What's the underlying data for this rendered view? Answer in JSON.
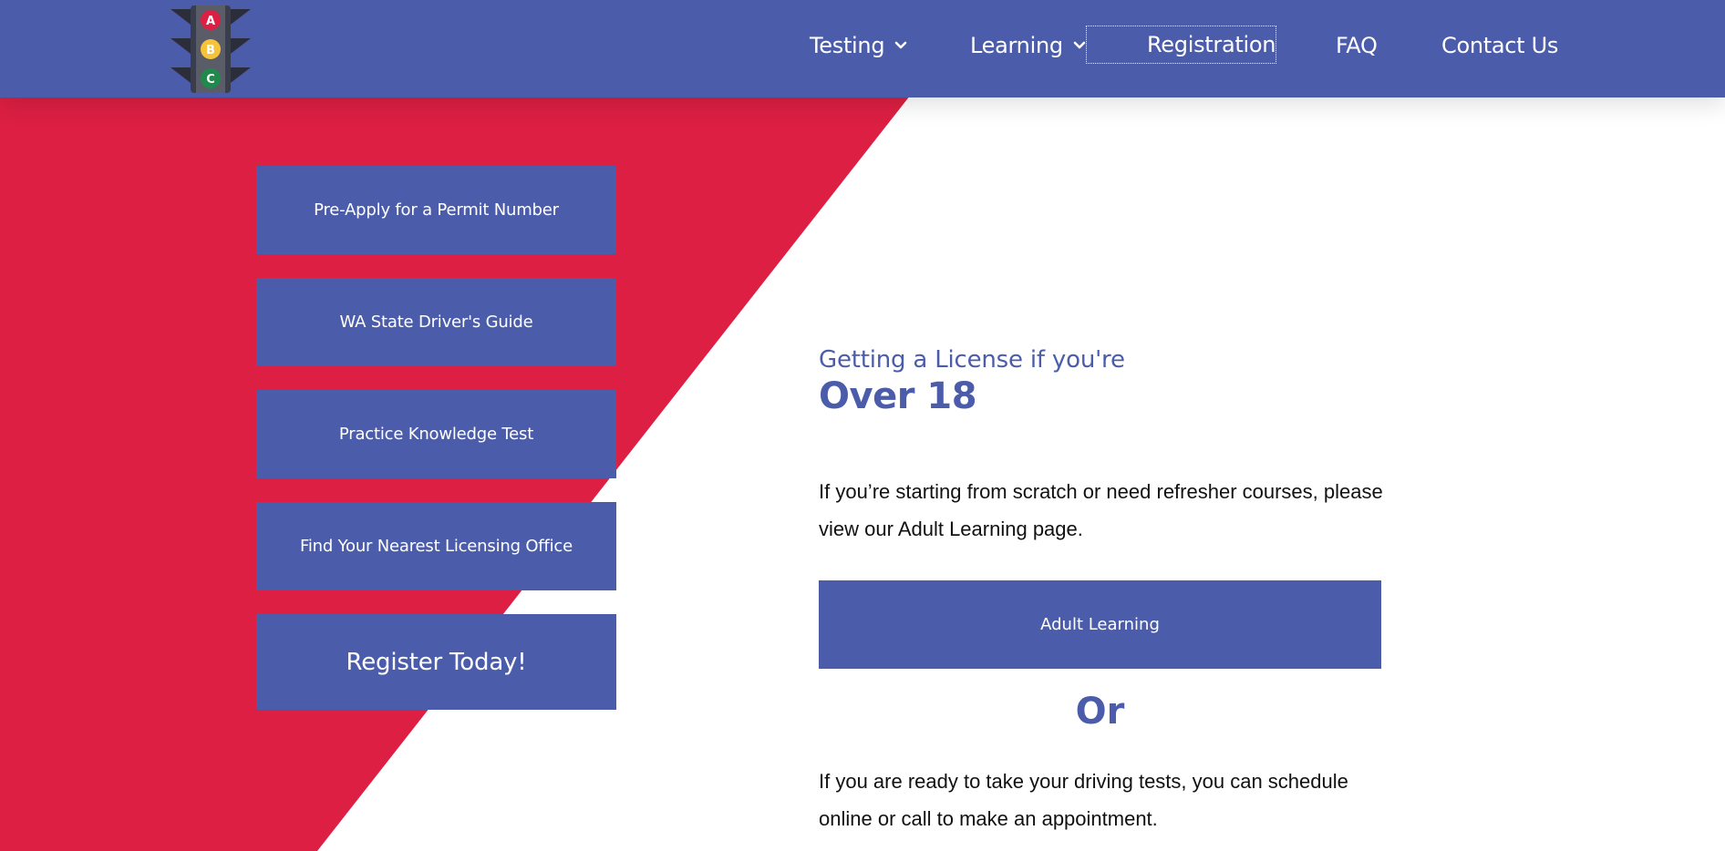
{
  "colors": {
    "brand_blue": "#4b5cab",
    "accent_red": "#dc1f42",
    "background": "#ffffff",
    "text_dark": "#111111"
  },
  "header": {
    "logo": {
      "icon": "traffic-light-icon",
      "lights": [
        "A",
        "B",
        "C"
      ]
    },
    "nav": {
      "testing": "Testing",
      "learning": "Learning",
      "registration": "Registration",
      "faq": "FAQ",
      "contact": "Contact Us"
    }
  },
  "sidebar": {
    "buttons": [
      "Pre-Apply for a Permit Number",
      "WA State Driver's Guide",
      "Practice Knowledge Test",
      "Find Your Nearest Licensing Office",
      "Register Today!"
    ]
  },
  "main": {
    "pre_title": "Getting a License if you're",
    "title": "Over 18",
    "para1": "If you’re starting from scratch or need refresher courses, please view our Adult Learning page.",
    "cta_label": "Adult Learning",
    "or": "Or",
    "para2": "If you are ready to take your driving tests, you can schedule online or call to make an appointment."
  }
}
